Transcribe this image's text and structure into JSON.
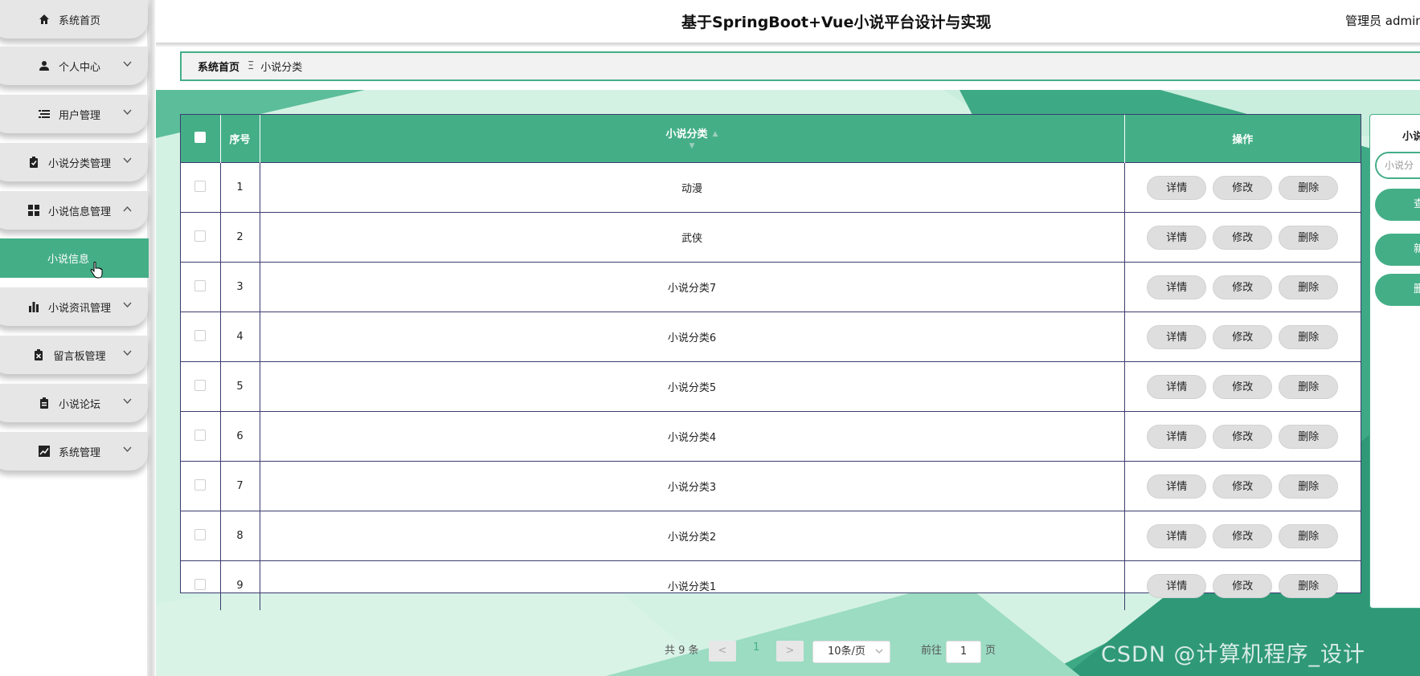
{
  "header": {
    "title": "基于SpringBoot+Vue小说平台设计与实现",
    "user": "管理员 admin"
  },
  "sidebar": {
    "items": [
      {
        "label": "系统首页",
        "icon": "home-icon"
      },
      {
        "label": "个人中心",
        "icon": "user-icon"
      },
      {
        "label": "用户管理",
        "icon": "list-icon"
      },
      {
        "label": "小说分类管理",
        "icon": "clipboard-check-icon"
      },
      {
        "label": "小说信息管理",
        "icon": "grid-icon"
      },
      {
        "label": "小说资讯管理",
        "icon": "bar-chart-icon"
      },
      {
        "label": "留言板管理",
        "icon": "clipboard-x-icon"
      },
      {
        "label": "小说论坛",
        "icon": "clipboard-icon"
      },
      {
        "label": "系统管理",
        "icon": "trend-chart-icon"
      }
    ],
    "active_sub": "小说信息"
  },
  "breadcrumb": {
    "home": "系统首页",
    "separator": "Ξ",
    "current": "小说分类"
  },
  "table": {
    "columns": [
      "序号",
      "小说分类",
      "操作"
    ],
    "rows": [
      {
        "index": "1",
        "category": "动漫"
      },
      {
        "index": "2",
        "category": "武侠"
      },
      {
        "index": "3",
        "category": "小说分类7"
      },
      {
        "index": "4",
        "category": "小说分类6"
      },
      {
        "index": "5",
        "category": "小说分类5"
      },
      {
        "index": "6",
        "category": "小说分类4"
      },
      {
        "index": "7",
        "category": "小说分类3"
      },
      {
        "index": "8",
        "category": "小说分类2"
      },
      {
        "index": "9",
        "category": "小说分类1"
      }
    ],
    "actions": {
      "detail": "详情",
      "edit": "修改",
      "delete": "删除"
    }
  },
  "search_panel": {
    "label": "小说",
    "placeholder": "小说分",
    "query_button": "查",
    "add_button": "新",
    "delete_button": "删"
  },
  "pagination": {
    "total": "共 9 条",
    "prev": "<",
    "current": "1",
    "next": ">",
    "page_size": "10条/页",
    "goto_prefix": "前往",
    "goto_value": "1",
    "goto_suffix": "页"
  },
  "watermark": "CSDN @计算机程序_设计",
  "colors": {
    "accent": "#44ae87",
    "table_border": "#3c3c6e"
  }
}
